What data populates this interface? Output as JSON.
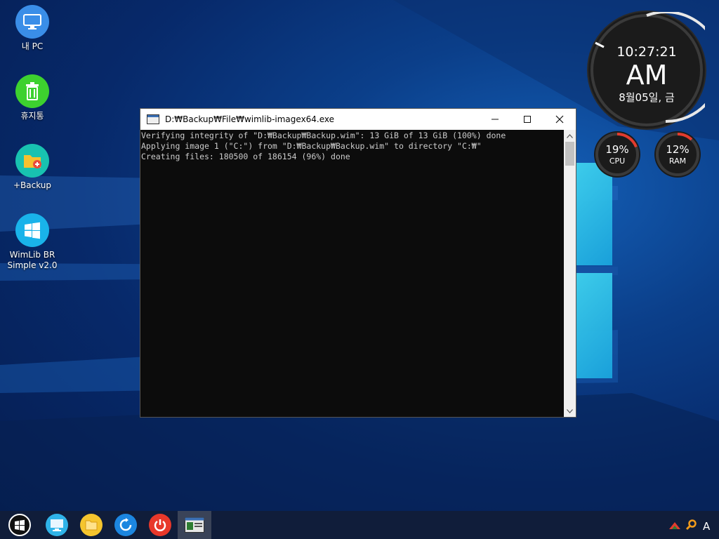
{
  "desktop": {
    "icons": [
      {
        "label": "내 PC",
        "icon": "monitor-icon"
      },
      {
        "label": "휴지통",
        "icon": "trash-icon"
      },
      {
        "label": "+Backup",
        "icon": "folder-add-icon"
      },
      {
        "label_line1": "WimLib BR",
        "label_line2": "Simple v2.0",
        "icon": "windows-logo-icon"
      }
    ]
  },
  "clock": {
    "time": "10:27:21",
    "ampm": "AM",
    "date": "8월05일, 금"
  },
  "gauges": {
    "cpu": {
      "value": "19%",
      "label": "CPU",
      "fraction": 0.19
    },
    "ram": {
      "value": "12%",
      "label": "RAM",
      "fraction": 0.12
    }
  },
  "window": {
    "title": "D:₩Backup₩File₩wimlib-imagex64.exe",
    "minimize_label": "—",
    "maximize_label": "☐",
    "close_label": "✕",
    "lines": [
      "Verifying integrity of \"D:₩Backup₩Backup.wim\": 13 GiB of 13 GiB (100%) done",
      "Applying image 1 (\"C:\") from \"D:₩Backup₩Backup.wim\" to directory \"C:₩\"",
      "Creating files: 180500 of 186154 (96%) done"
    ]
  },
  "taskbar": {
    "items": [
      "start-button",
      "this-pc-icon",
      "file-explorer-icon",
      "refresh-icon",
      "power-icon",
      "console-window-icon"
    ],
    "tray_text": "A"
  }
}
